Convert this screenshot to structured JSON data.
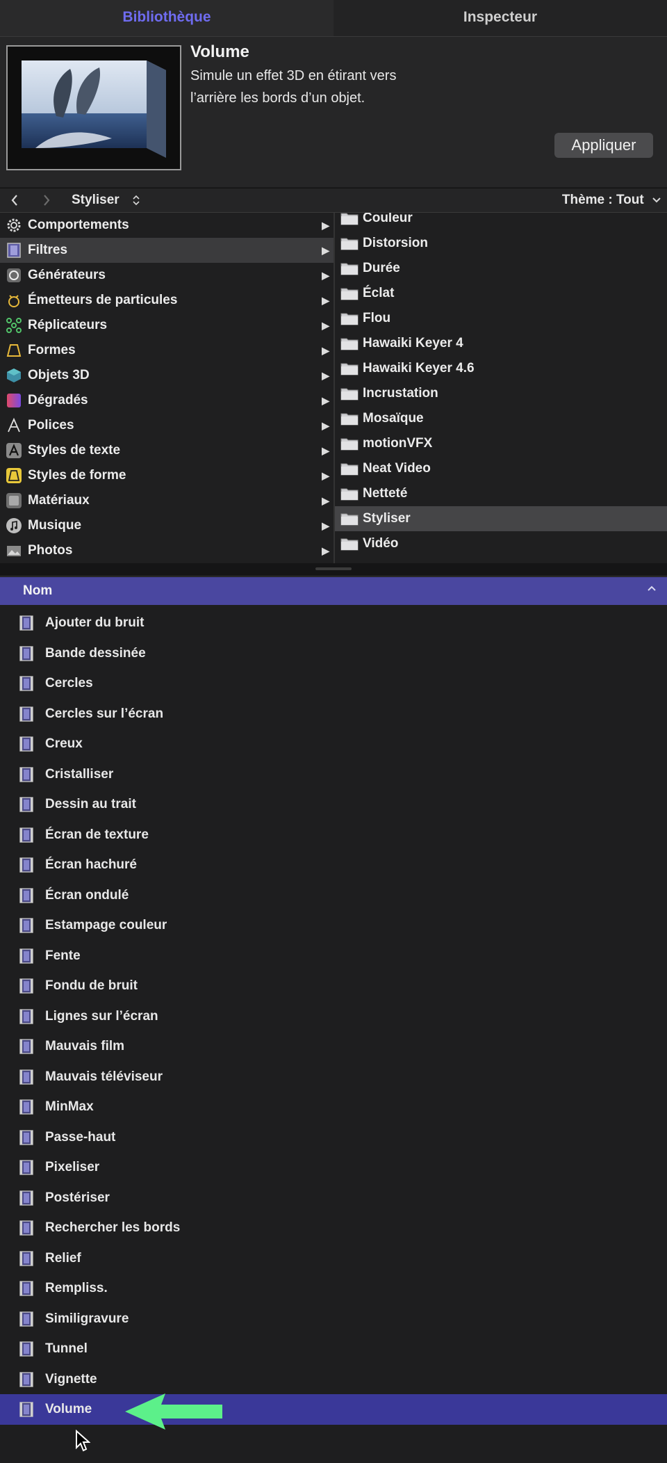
{
  "tabs": [
    {
      "label": "Bibliothèque",
      "active": true
    },
    {
      "label": "Inspecteur",
      "active": false
    }
  ],
  "preview": {
    "title": "Volume",
    "description": "Simule un effet 3D en étirant vers l’arrière les bords d’un objet.",
    "apply_label": "Appliquer"
  },
  "navbar": {
    "back_icon": "chevron-left-icon",
    "forward_icon": "chevron-right-icon",
    "folder": "Styliser",
    "theme": "Thème : Tout"
  },
  "categories": [
    {
      "label": "Comportements",
      "icon": "gear-icon",
      "selected": false
    },
    {
      "label": "Filtres",
      "icon": "film-icon",
      "selected": true
    },
    {
      "label": "Générateurs",
      "icon": "generator-icon",
      "selected": false
    },
    {
      "label": "Émetteurs de particules",
      "icon": "emitter-icon",
      "selected": false
    },
    {
      "label": "Réplicateurs",
      "icon": "replicator-icon",
      "selected": false
    },
    {
      "label": "Formes",
      "icon": "shape-icon",
      "selected": false
    },
    {
      "label": "Objets 3D",
      "icon": "cube-icon",
      "selected": false
    },
    {
      "label": "Dégradés",
      "icon": "gradient-icon",
      "selected": false
    },
    {
      "label": "Polices",
      "icon": "font-icon",
      "selected": false
    },
    {
      "label": "Styles de texte",
      "icon": "text-style-icon",
      "selected": false
    },
    {
      "label": "Styles de forme",
      "icon": "shape-style-icon",
      "selected": false
    },
    {
      "label": "Matériaux",
      "icon": "material-icon",
      "selected": false
    },
    {
      "label": "Musique",
      "icon": "music-icon",
      "selected": false
    },
    {
      "label": "Photos",
      "icon": "photo-icon",
      "selected": false
    }
  ],
  "folders": [
    {
      "label": "Couleur",
      "selected": false
    },
    {
      "label": "Distorsion",
      "selected": false
    },
    {
      "label": "Durée",
      "selected": false
    },
    {
      "label": "Éclat",
      "selected": false
    },
    {
      "label": "Flou",
      "selected": false
    },
    {
      "label": "Hawaiki Keyer 4",
      "selected": false
    },
    {
      "label": "Hawaiki Keyer 4.6",
      "selected": false
    },
    {
      "label": "Incrustation",
      "selected": false
    },
    {
      "label": "Mosaïque",
      "selected": false
    },
    {
      "label": "motionVFX",
      "selected": false
    },
    {
      "label": "Neat Video",
      "selected": false
    },
    {
      "label": "Netteté",
      "selected": false
    },
    {
      "label": "Styliser",
      "selected": true
    },
    {
      "label": "Vidéo",
      "selected": false
    }
  ],
  "list": {
    "header": "Nom",
    "items": [
      {
        "label": "Ajouter du bruit",
        "selected": false
      },
      {
        "label": "Bande dessinée",
        "selected": false
      },
      {
        "label": "Cercles",
        "selected": false
      },
      {
        "label": "Cercles sur l’écran",
        "selected": false
      },
      {
        "label": "Creux",
        "selected": false
      },
      {
        "label": "Cristalliser",
        "selected": false
      },
      {
        "label": "Dessin au trait",
        "selected": false
      },
      {
        "label": "Écran de texture",
        "selected": false
      },
      {
        "label": "Écran hachuré",
        "selected": false
      },
      {
        "label": "Écran ondulé",
        "selected": false
      },
      {
        "label": "Estampage couleur",
        "selected": false
      },
      {
        "label": "Fente",
        "selected": false
      },
      {
        "label": "Fondu de bruit",
        "selected": false
      },
      {
        "label": "Lignes sur l’écran",
        "selected": false
      },
      {
        "label": "Mauvais film",
        "selected": false
      },
      {
        "label": "Mauvais téléviseur",
        "selected": false
      },
      {
        "label": "MinMax",
        "selected": false
      },
      {
        "label": "Passe-haut",
        "selected": false
      },
      {
        "label": "Pixeliser",
        "selected": false
      },
      {
        "label": "Postériser",
        "selected": false
      },
      {
        "label": "Rechercher les bords",
        "selected": false
      },
      {
        "label": "Relief",
        "selected": false
      },
      {
        "label": "Rempliss.",
        "selected": false
      },
      {
        "label": "Similigravure",
        "selected": false
      },
      {
        "label": "Tunnel",
        "selected": false
      },
      {
        "label": "Vignette",
        "selected": false
      },
      {
        "label": "Volume",
        "selected": true
      }
    ]
  },
  "colors": {
    "accent": "#6f6cf0",
    "header_bg": "#4a47a0",
    "selected_row": "#3a3899",
    "annotation_arrow": "#5cf08a"
  }
}
